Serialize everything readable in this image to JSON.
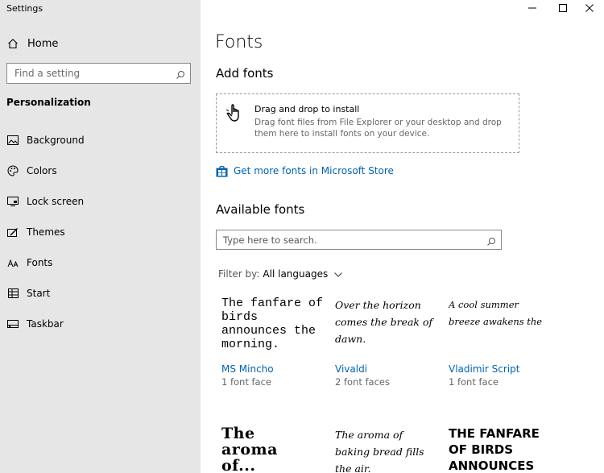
{
  "window": {
    "title": "Settings",
    "controls": {
      "minimize": "—",
      "maximize": "☐",
      "close": "✕"
    }
  },
  "sidebar": {
    "home_label": "Home",
    "search_placeholder": "Find a setting",
    "section_title": "Personalization",
    "items": [
      {
        "label": "Background",
        "icon": "image-icon"
      },
      {
        "label": "Colors",
        "icon": "palette-icon"
      },
      {
        "label": "Lock screen",
        "icon": "lock-screen-icon"
      },
      {
        "label": "Themes",
        "icon": "brush-icon"
      },
      {
        "label": "Fonts",
        "icon": "fonts-icon"
      },
      {
        "label": "Start",
        "icon": "start-icon"
      },
      {
        "label": "Taskbar",
        "icon": "taskbar-icon"
      }
    ]
  },
  "main": {
    "title": "Fonts",
    "add_fonts": {
      "heading": "Add fonts",
      "drop_title": "Drag and drop to install",
      "drop_text": "Drag font files from File Explorer or your desktop and drop them here to install fonts on your device."
    },
    "store_link": "Get more fonts in Microsoft Store",
    "available": {
      "heading": "Available fonts",
      "search_placeholder": "Type here to search.",
      "filter_label": "Filter by:",
      "filter_value": "All languages"
    },
    "fonts": [
      {
        "sample": "The fanfare of birds announces the morning.",
        "name": "MS Mincho",
        "faces": "1 font face"
      },
      {
        "sample": "Over the horizon comes the break of dawn.",
        "name": "Vivaldi",
        "faces": "2 font faces"
      },
      {
        "sample": "A cool summer breeze awakens the trees.",
        "name": "Vladimir Script",
        "faces": "1 font face"
      },
      {
        "sample": "The aroma of..."
      },
      {
        "sample": "The aroma of baking bread fills the air."
      },
      {
        "sample": "THE FANFARE OF BIRDS ANNOUNCES"
      }
    ]
  },
  "colors": {
    "accent": "#0063b1",
    "sidebar_bg": "#e6e6e6",
    "main_bg": "#ffffff"
  }
}
